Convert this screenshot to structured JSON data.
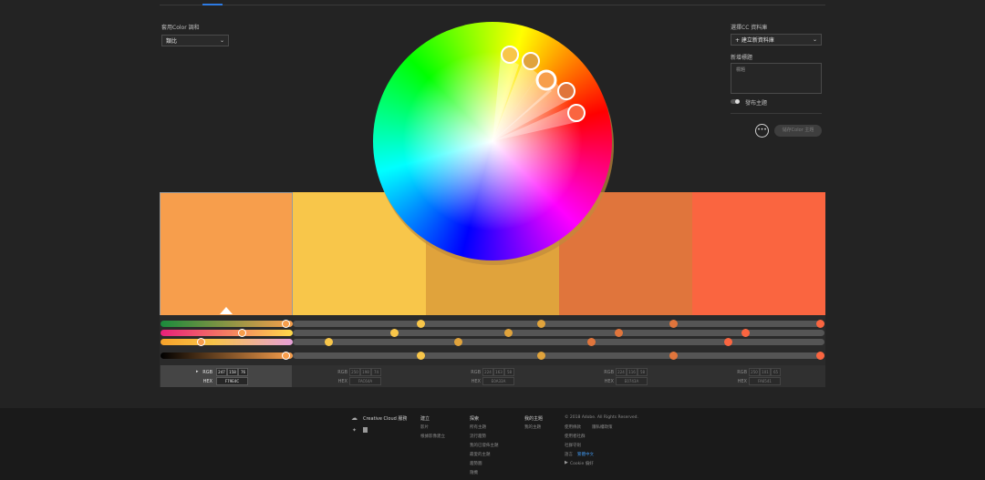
{
  "left": {
    "harmony_label": "套用Color 調和",
    "harmony_value": "類比"
  },
  "right": {
    "library_label": "選擇CC 資料庫",
    "library_value": "+ 建立新資料庫",
    "title_label": "新增標題",
    "title_placeholder": "標題",
    "publish_label": "發布主題",
    "more_label": "•••",
    "save_label": "儲存Color 主題"
  },
  "colors": {
    "background": "#232323",
    "accent": "#2d7be3"
  },
  "swatches": [
    {
      "hex": "#F79E4C"
    },
    {
      "hex": "#F8C64A"
    },
    {
      "hex": "#E0A33C"
    },
    {
      "hex": "#E0753C"
    },
    {
      "hex": "#FA6540"
    }
  ],
  "info": [
    {
      "rgb_label": "RGB",
      "hex_label": "HEX",
      "r": "247",
      "g": "158",
      "b": "76",
      "hex": "F79E4C"
    },
    {
      "rgb_label": "RGB",
      "hex_label": "HEX",
      "r": "250",
      "g": "198",
      "b": "74",
      "hex": "FAC64A"
    },
    {
      "rgb_label": "RGB",
      "hex_label": "HEX",
      "r": "224",
      "g": "163",
      "b": "58",
      "hex": "E0A33A"
    },
    {
      "rgb_label": "RGB",
      "hex_label": "HEX",
      "r": "224",
      "g": "116",
      "b": "58",
      "hex": "E0743A"
    },
    {
      "rgb_label": "RGB",
      "hex_label": "HEX",
      "r": "250",
      "g": "101",
      "b": "65",
      "hex": "FA6541"
    }
  ],
  "footer": {
    "cc_label": "Creative Cloud 服務",
    "col1": {
      "head": "建立",
      "links": [
        "影片",
        "根據影像建立"
      ]
    },
    "col2": {
      "head": "探索",
      "links": [
        "所有主題",
        "流行趨勢",
        "我的已發佈主題",
        "最愛的主題",
        "趨勢圖",
        "隨機"
      ]
    },
    "col3": {
      "head": "我的主題",
      "links": [
        "我的主題"
      ]
    },
    "col4": {
      "copyright": "© 2018 Adobe. All Rights Reserved.",
      "links": [
        "使用條款",
        "隱私權政策",
        "使用者社群",
        "社群守則"
      ],
      "lang_label": "語言",
      "lang_value": "繁體中文",
      "cookie": "Cookie 偏好"
    }
  }
}
